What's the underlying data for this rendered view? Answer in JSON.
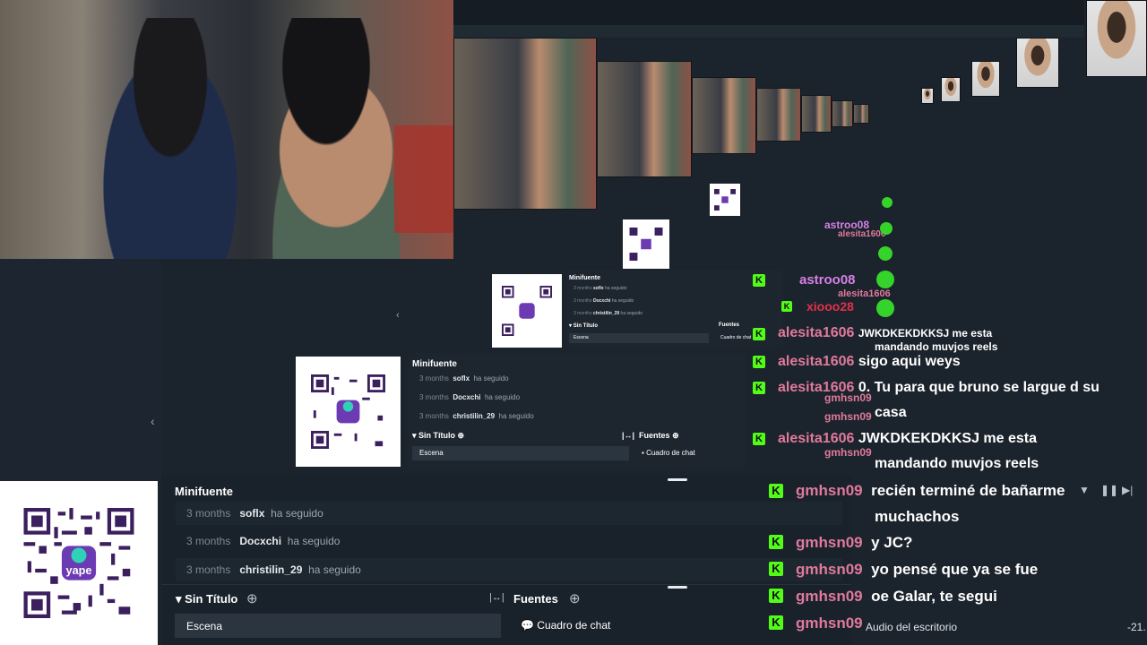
{
  "panel": {
    "title": "Minifuente",
    "follows": [
      {
        "ago": "3 months",
        "user": "soflx",
        "action": "ha seguido"
      },
      {
        "ago": "3 months",
        "user": "Docxchi",
        "action": "ha seguido"
      },
      {
        "ago": "3 months",
        "user": "christilin_29",
        "action": "ha seguido"
      }
    ],
    "scenes_title": "Sin Título",
    "scene_item": "Escena",
    "sources_title": "Fuentes",
    "source_item": "Cuadro de chat"
  },
  "chat": {
    "badge": "K",
    "lines": [
      {
        "user": "gmhsn09",
        "msg": "recién terminé de bañarme"
      },
      {
        "user": "",
        "msg": "muchachos"
      },
      {
        "user": "gmhsn09",
        "msg": "y JC?"
      },
      {
        "user": "gmhsn09",
        "msg": "yo pensé que ya se fue"
      },
      {
        "user": "gmhsn09",
        "msg": "oe Galar, te segui"
      },
      {
        "user": "gmhsn09",
        "msg": "Audio del escritorio"
      }
    ],
    "mid_lines": [
      {
        "user": "alesita1606",
        "msg": "JWKDKEKDKKSJ me esta"
      },
      {
        "user": "",
        "msg": "mandando muvjos reels"
      },
      {
        "user": "alesita1606",
        "msg": "sigo aqui weys"
      },
      {
        "user": "alesita1606",
        "msg": "0. Tu para que bruno se largue d su"
      },
      {
        "user": "",
        "msg": "casa"
      },
      {
        "user": "alesita1606",
        "msg": "JWKDKEKDKKSJ me esta"
      },
      {
        "user": "",
        "msg": "mandando muvjos reels"
      }
    ],
    "small_users": [
      "astroo08",
      "xiooo28",
      "alesita1606",
      "gmhsn09"
    ],
    "audio_value": "-21."
  },
  "colors": {
    "kick_green": "#53fc18",
    "username": "#e07a9c",
    "panel_bg": "#19222a"
  }
}
